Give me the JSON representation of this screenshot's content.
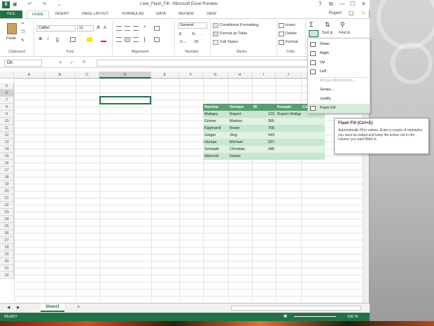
{
  "window": {
    "title": "Liste_Flash_Fill - Microsoft Excel Preview",
    "app_icon": "X",
    "controls": {
      "help": "?",
      "restore": "⧉",
      "minimize": "—",
      "maximize": "☐",
      "close": "✕"
    }
  },
  "tabs": [
    "FILE",
    "HOME",
    "INSERT",
    "PAGE LAYOUT",
    "FORMULAS",
    "DATA",
    "REVIEW",
    "VIEW"
  ],
  "user": {
    "name": "Rupert",
    "smiley": "☺"
  },
  "ribbon": {
    "clipboard": {
      "paste": "Paste",
      "label": "Clipboard"
    },
    "font": {
      "name": "Calibri",
      "size": "11",
      "bold": "B",
      "italic": "I",
      "underline": "U",
      "grow": "A",
      "shrink": "A",
      "label": "Font"
    },
    "alignment": {
      "label": "Alignment"
    },
    "number": {
      "format": "General",
      "dollar": "$",
      "percent": "%",
      "comma": ",",
      "label": "Number"
    },
    "styles": {
      "conditional": "Conditional Formatting",
      "table": "Format as Table",
      "cell": "Cell Styles",
      "label": "Styles"
    },
    "cells": {
      "insert": "Insert",
      "delete": "Delete",
      "format": "Format",
      "label": "Cells"
    },
    "editing": {
      "sigma": "Σ",
      "sort": "Sort &",
      "find": "Find &"
    }
  },
  "formula_bar": {
    "name_box": "D6",
    "fx": "fx",
    "content": ""
  },
  "columns": [
    "A",
    "B",
    "C",
    "D",
    "E",
    "F",
    "G",
    "H",
    "I",
    "J",
    "K"
  ],
  "selected_column": "D",
  "rows": [
    "5",
    "6",
    "7",
    "8",
    "9",
    "10",
    "11",
    "12",
    "13",
    "14",
    "15",
    "16",
    "17",
    "18",
    "19",
    "20",
    "21",
    "22",
    "23",
    "24",
    "25",
    "26",
    "27",
    "28",
    "29",
    "30",
    "31",
    "32"
  ],
  "visible_rows": [
    "",
    "5",
    "6",
    "7",
    "8",
    "9",
    "10",
    "11",
    "12",
    "13",
    "14",
    "15",
    "16",
    "17",
    "18",
    "19",
    "20",
    "21",
    "22",
    "23",
    "24",
    "25",
    "26",
    "27",
    "28",
    "29",
    "30",
    "31",
    "32"
  ],
  "selected_row": "6",
  "table": {
    "headers": [
      "Nachna",
      "Vornam",
      "ID",
      "Komple",
      "Co"
    ],
    "rows": [
      {
        "nachname": "Mattgey",
        "vorname": "Rupert",
        "id": "123",
        "komplett": "Rupert Mattgey"
      },
      {
        "nachname": "Grimm",
        "vorname": "Markus",
        "id": "365",
        "komplett": ""
      },
      {
        "nachname": "Kipphardt",
        "vorname": "Beate",
        "id": "768",
        "komplett": ""
      },
      {
        "nachname": "Geiger",
        "vorname": "Jörg",
        "id": "543",
        "komplett": ""
      },
      {
        "nachname": "Humpe",
        "vorname": "Michael",
        "id": "237",
        "komplett": ""
      },
      {
        "nachname": "Schwalb",
        "vorname": "Christian",
        "id": "345",
        "komplett": ""
      },
      {
        "nachname": "Albrecht",
        "vorname": "Daniel",
        "id": "",
        "komplett": ""
      }
    ]
  },
  "fill_menu": {
    "items": [
      {
        "label": "Down",
        "disabled": false
      },
      {
        "label": "Right",
        "disabled": false
      },
      {
        "label": "Up",
        "disabled": false
      },
      {
        "label": "Left",
        "disabled": false
      },
      {
        "label": "Across Worksheets...",
        "disabled": true
      },
      {
        "label": "Series...",
        "disabled": false
      },
      {
        "label": "Justify",
        "disabled": false
      },
      {
        "label": "Flash Fill",
        "disabled": false
      }
    ]
  },
  "tooltip": {
    "title": "Flash Fill (Ctrl+E)",
    "body": "Automatically fill in values. Enter a couple of examples you want as output and keep the active cell in the column you want filled in."
  },
  "sheet": {
    "tab": "Sheet1",
    "add": "+"
  },
  "status": {
    "ready": "READY",
    "zoom": "100 %"
  },
  "colors": {
    "excel_green": "#217346",
    "table_header": "#5a9e6f",
    "table_band": "#c6e8cf"
  }
}
